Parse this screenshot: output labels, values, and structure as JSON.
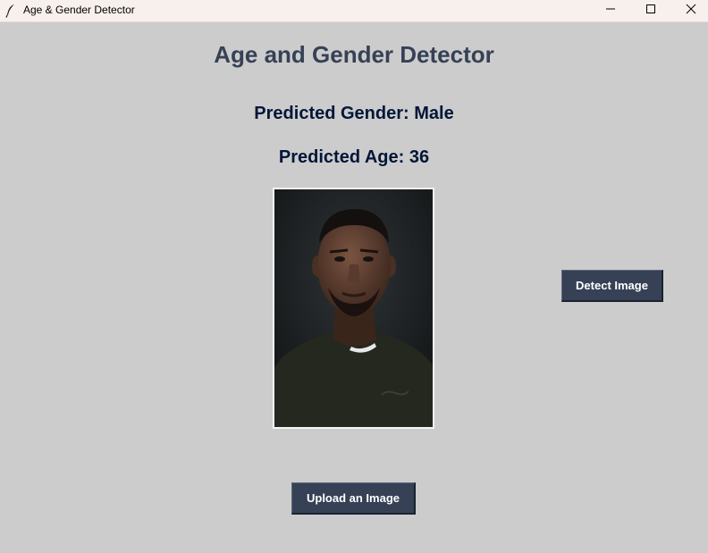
{
  "window": {
    "title": "Age & Gender Detector"
  },
  "main": {
    "heading": "Age and Gender Detector",
    "predicted_gender": "Predicted Gender: Male",
    "predicted_age": "Predicted Age: 36"
  },
  "buttons": {
    "detect_label": "Detect Image",
    "upload_label": "Upload an Image"
  },
  "icons": {
    "app": "feather-icon",
    "minimize": "minimize-icon",
    "maximize": "maximize-icon",
    "close": "close-icon"
  },
  "colors": {
    "background": "#cccccc",
    "heading": "#364156",
    "prediction_text": "#011638",
    "button_bg": "#364156",
    "button_text": "#ffffff",
    "titlebar_bg": "#f8f0ec"
  }
}
